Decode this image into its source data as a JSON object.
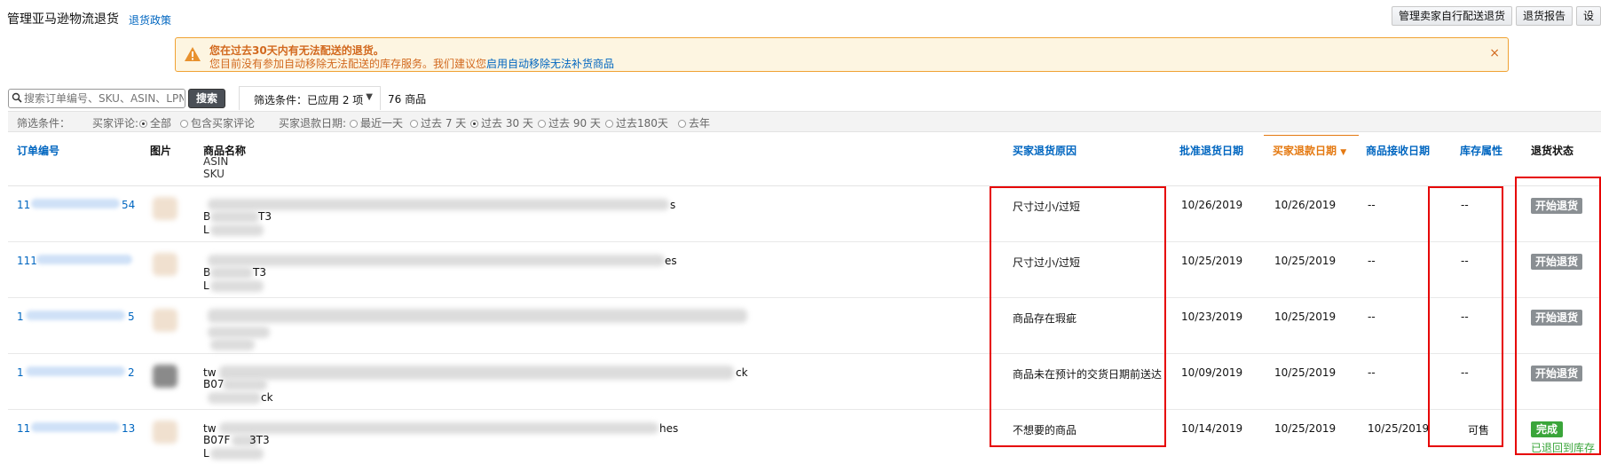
{
  "header": {
    "title": "管理亚马逊物流退货",
    "policy_link": "退货政策",
    "buttons": [
      "管理卖家自行配送退货",
      "退货报告",
      "设"
    ]
  },
  "alert": {
    "title": "您在过去30天内有无法配送的退货。",
    "text": "您目前没有参加自动移除无法配送的库存服务。我们建议您",
    "link": "启用自动移除无法补货商品",
    "close": "×",
    "icon": "warning-icon"
  },
  "search": {
    "placeholder": "搜索订单编号、SKU、ASIN、LPN",
    "button": "搜索",
    "filter_dropdown": "筛选条件：已应用 2 项",
    "count": "76 商品"
  },
  "filters": {
    "label": "筛选条件：",
    "review_label": "买家评论:",
    "review_options": [
      {
        "label": "全部",
        "selected": true
      },
      {
        "label": "包含买家评论",
        "selected": false
      }
    ],
    "date_label": "买家退款日期:",
    "date_options": [
      {
        "label": "最近一天",
        "selected": false
      },
      {
        "label": "过去 7 天",
        "selected": false
      },
      {
        "label": "过去 30 天",
        "selected": true
      },
      {
        "label": "过去 90 天",
        "selected": false
      },
      {
        "label": "过去180天",
        "selected": false
      },
      {
        "label": "去年",
        "selected": false
      }
    ]
  },
  "table": {
    "headers": {
      "order": "订单编号",
      "image": "图片",
      "name": "商品名称",
      "asin": "ASIN",
      "sku": "SKU",
      "reason": "买家退货原因",
      "approved": "批准退货日期",
      "refund": "买家退款日期",
      "received": "商品接收日期",
      "inventory": "库存属性",
      "status": "退货状态"
    },
    "rows": [
      {
        "order_start": "11",
        "order_end": "54",
        "name_end": "s",
        "asin_frag": "B",
        "asin_end": "T3",
        "sku_frag": "L",
        "reason": "尺寸过小/过短",
        "approved": "10/26/2019",
        "refund": "10/26/2019",
        "received": "--",
        "inventory": "--",
        "status": "开始退货",
        "status_note": ""
      },
      {
        "order_start": "111",
        "order_end": "",
        "name_end": "es",
        "asin_frag": "B",
        "asin_end": "T3",
        "sku_frag": "L",
        "reason": "尺寸过小/过短",
        "approved": "10/25/2019",
        "refund": "10/25/2019",
        "received": "--",
        "inventory": "--",
        "status": "开始退货",
        "status_note": ""
      },
      {
        "order_start": "1",
        "order_end": "5",
        "name_end": "",
        "asin_frag": "",
        "asin_end": "",
        "sku_frag": "",
        "reason": "商品存在瑕疵",
        "approved": "10/23/2019",
        "refund": "10/25/2019",
        "received": "--",
        "inventory": "--",
        "status": "开始退货",
        "status_note": ""
      },
      {
        "order_start": "1",
        "order_end": "2",
        "name_start": "tw",
        "name_end": "ck",
        "asin_frag": "B07",
        "asin_end": "",
        "sku_frag": "ck",
        "reason": "商品未在预计的交货日期前送达",
        "approved": "10/09/2019",
        "refund": "10/25/2019",
        "received": "--",
        "inventory": "--",
        "status": "开始退货",
        "status_note": ""
      },
      {
        "order_start": "11",
        "order_end": "13",
        "name_start": "tw",
        "name_end": "hes",
        "asin_frag": "B07F",
        "asin_end": "3T3",
        "sku_frag": "L",
        "reason": "不想要的商品",
        "approved": "10/14/2019",
        "refund": "10/25/2019",
        "received": "10/25/2019",
        "inventory": "可售",
        "status": "完成",
        "status_note": "已退回到库存"
      }
    ]
  }
}
